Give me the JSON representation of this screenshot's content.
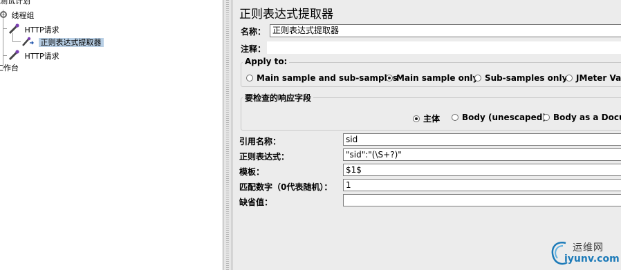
{
  "tree": {
    "items": [
      {
        "label": "测试计划"
      },
      {
        "label": "线程组"
      },
      {
        "label": "HTTP请求"
      },
      {
        "label": "正则表达式提取器"
      },
      {
        "label": "HTTP请求"
      },
      {
        "label": "工作台"
      }
    ]
  },
  "editor": {
    "title": "正则表达式提取器",
    "name_label": "名称：",
    "name_value": "正则表达式提取器",
    "comment_label": "注释：",
    "comment_value": "",
    "apply_to": {
      "legend": "Apply to:",
      "options": [
        "Main sample and sub-samples",
        "Main sample only",
        "Sub-samples only",
        "JMeter Variable"
      ],
      "selected": "Main sample only"
    },
    "response_field": {
      "legend": "要检查的响应字段",
      "options": [
        "主体",
        "Body (unescaped)",
        "Body as a Document"
      ],
      "selected": "主体"
    },
    "params": [
      {
        "label": "引用名称：",
        "value": "sid"
      },
      {
        "label": "正则表达式：",
        "value": "\"sid\":\"(\\S+?)\""
      },
      {
        "label": "模板：",
        "value": "$1$"
      },
      {
        "label": "匹配数字（0代表随机）：",
        "value": "1"
      },
      {
        "label": "缺省值：",
        "value": ""
      }
    ]
  },
  "watermark": {
    "line1": "运维网",
    "line2": "iyunv.com",
    "color": "#1c7ab8"
  }
}
